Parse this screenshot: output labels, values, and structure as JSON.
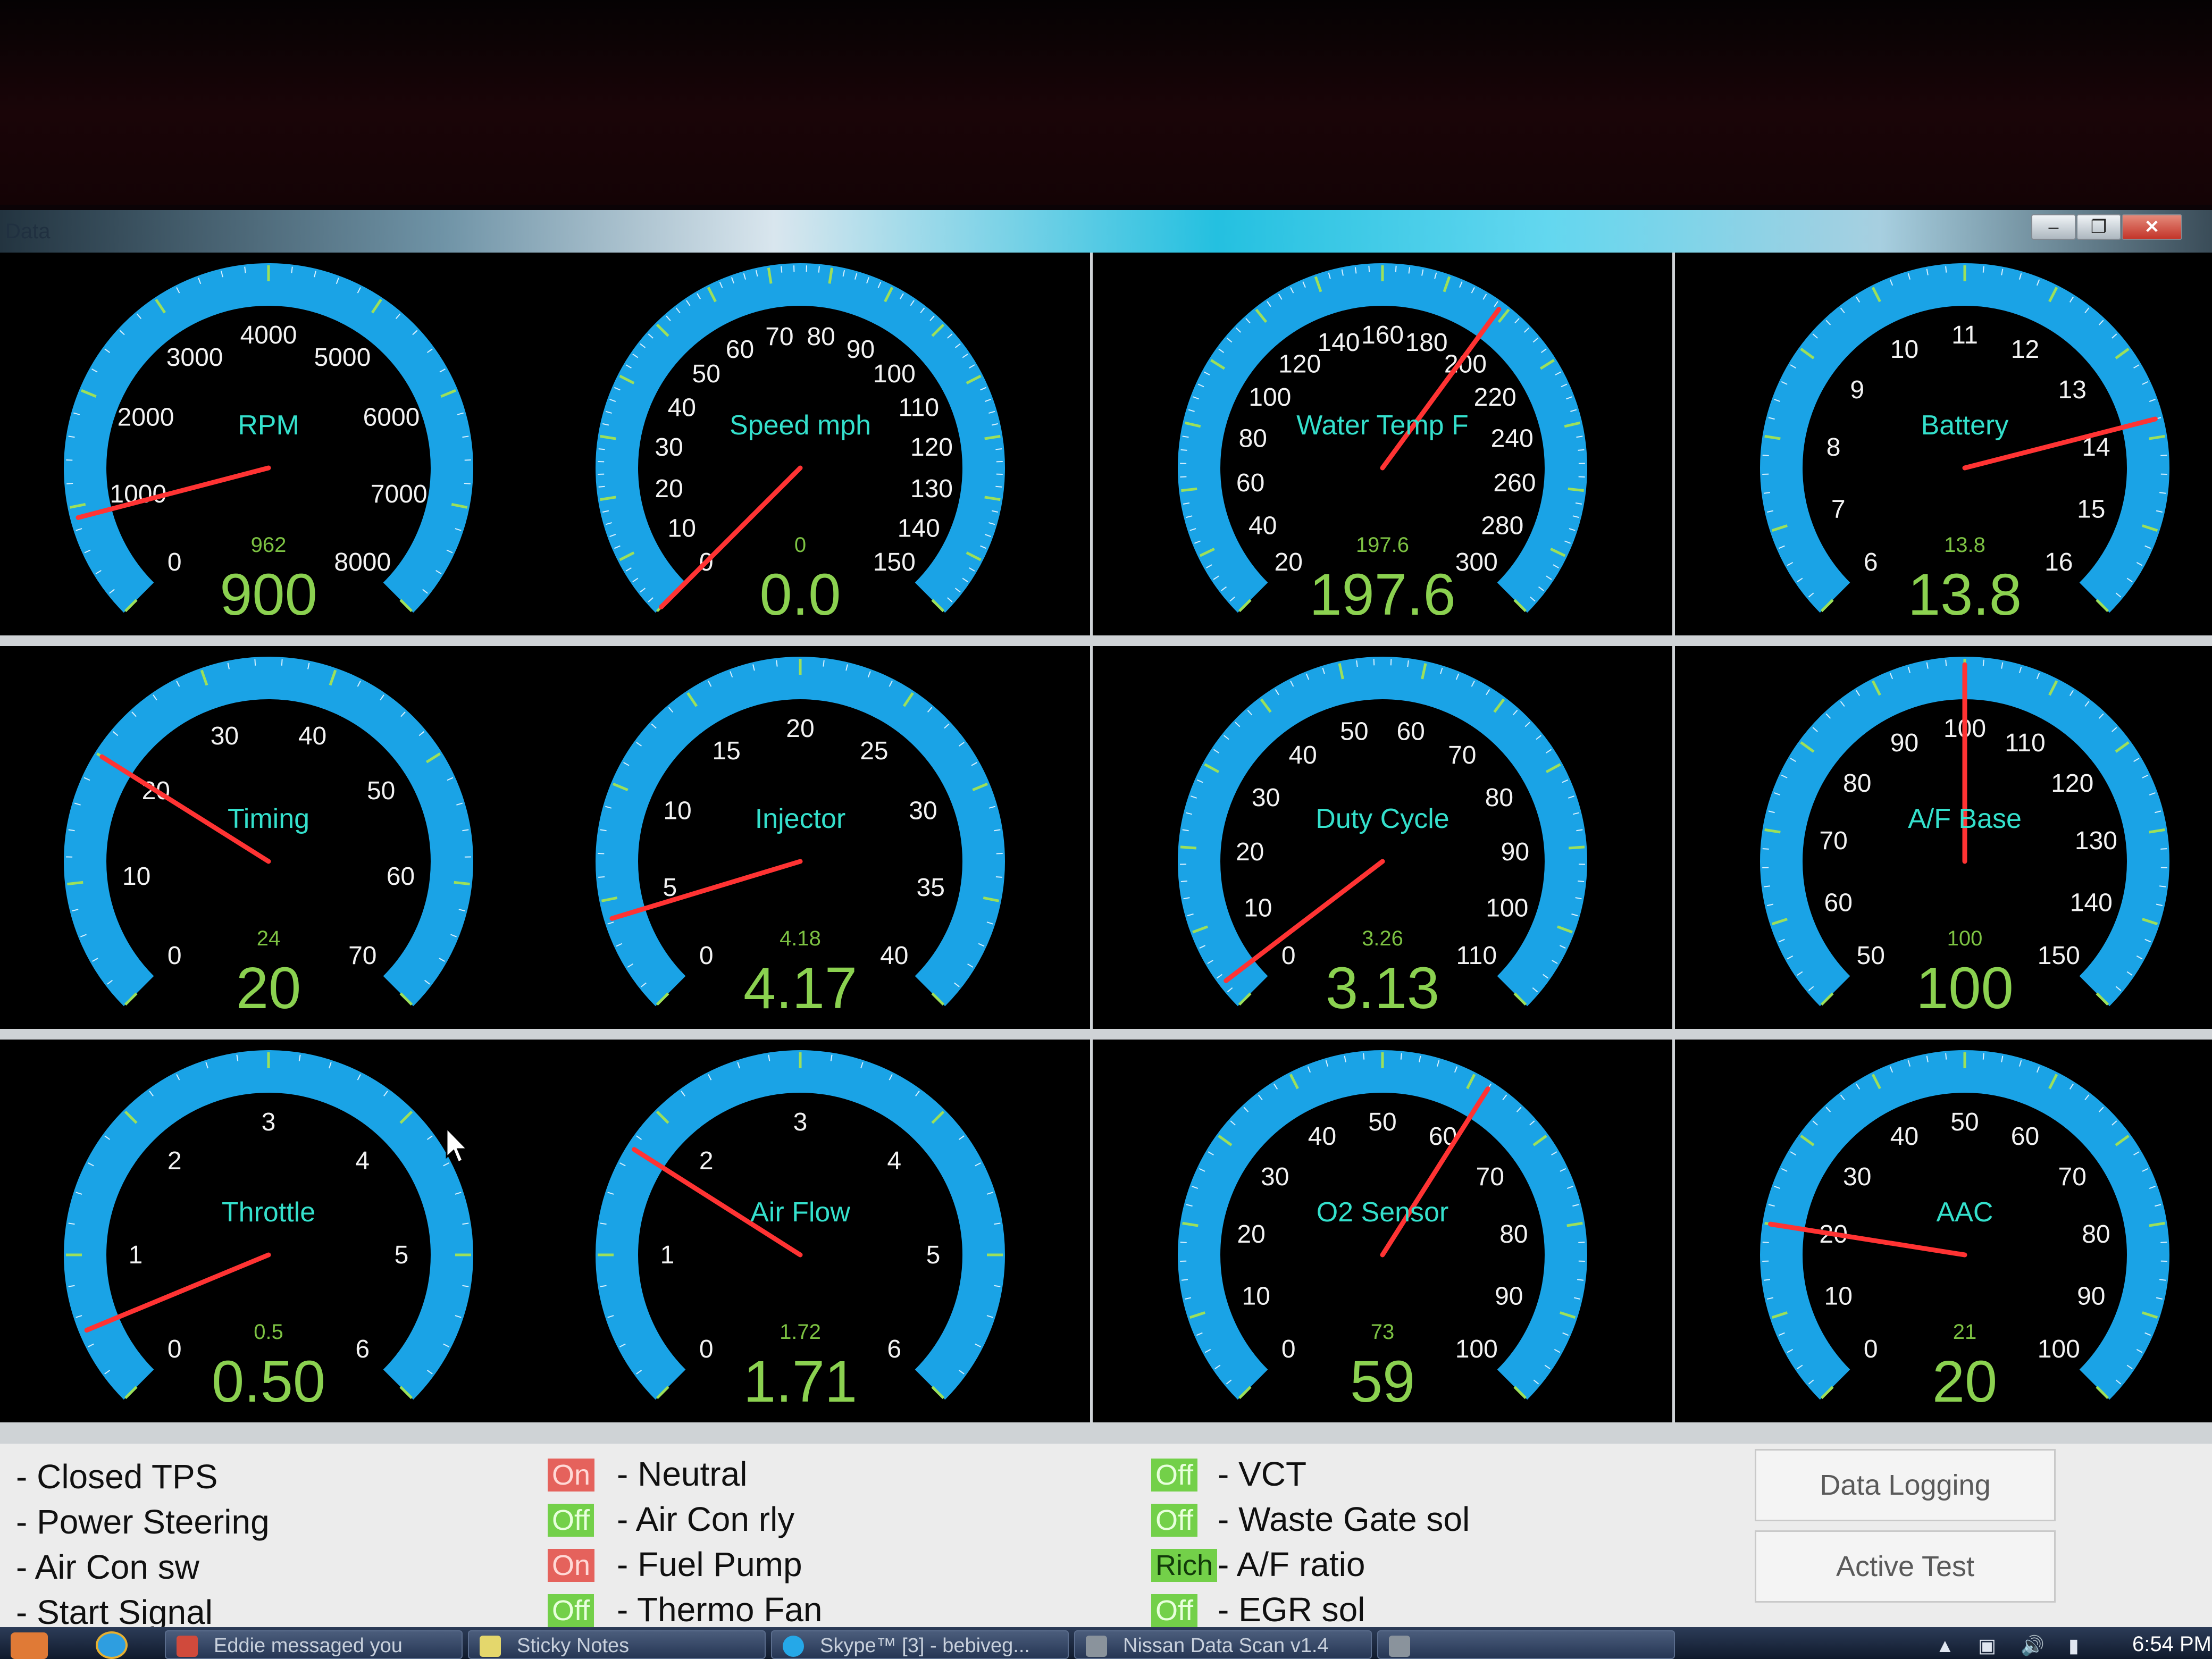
{
  "window": {
    "title": "Data",
    "min_label": "–",
    "max_label": "❐",
    "close_label": "✕"
  },
  "gauges": [
    {
      "label": "RPM",
      "min": 0,
      "max": 8000,
      "ticks": [
        "0",
        "1000",
        "2000",
        "3000",
        "4000",
        "5000",
        "6000",
        "7000",
        "8000"
      ],
      "needle": 900,
      "small": "962",
      "value": "900"
    },
    {
      "label": "Speed mph",
      "min": 0,
      "max": 150,
      "ticks": [
        "0",
        "10",
        "20",
        "30",
        "40",
        "50",
        "60",
        "70",
        "80",
        "90",
        "100",
        "110",
        "120",
        "130",
        "140",
        "150"
      ],
      "needle": 0,
      "small": "0",
      "value": "0.0"
    },
    {
      "label": "Water Temp F",
      "min": 20,
      "max": 300,
      "ticks": [
        "20",
        "40",
        "60",
        "80",
        "100",
        "120",
        "140",
        "160",
        "180",
        "200",
        "220",
        "240",
        "260",
        "280",
        "300"
      ],
      "needle": 197.6,
      "small": "197.6",
      "value": "197.6"
    },
    {
      "label": "Battery",
      "min": 6,
      "max": 16,
      "ticks": [
        "6",
        "7",
        "8",
        "9",
        "10",
        "11",
        "12",
        "13",
        "14",
        "15",
        "16"
      ],
      "needle": 13.8,
      "small": "13.8",
      "value": "13.8"
    },
    {
      "label": "Timing",
      "min": 0,
      "max": 70,
      "ticks": [
        "0",
        "10",
        "20",
        "30",
        "40",
        "50",
        "60",
        "70"
      ],
      "needle": 20,
      "small": "24",
      "value": "20"
    },
    {
      "label": "Injector",
      "min": 0,
      "max": 40,
      "ticks": [
        "0",
        "5",
        "10",
        "15",
        "20",
        "25",
        "30",
        "35",
        "40"
      ],
      "needle": 4.17,
      "small": "4.18",
      "value": "4.17"
    },
    {
      "label": "Duty Cycle",
      "min": 0,
      "max": 110,
      "ticks": [
        "0",
        "10",
        "20",
        "30",
        "40",
        "50",
        "60",
        "70",
        "80",
        "90",
        "100",
        "110"
      ],
      "needle": 3.13,
      "small": "3.26",
      "value": "3.13"
    },
    {
      "label": "A/F Base",
      "min": 50,
      "max": 150,
      "ticks": [
        "50",
        "60",
        "70",
        "80",
        "90",
        "100",
        "110",
        "120",
        "130",
        "140",
        "150"
      ],
      "needle": 100,
      "small": "100",
      "value": "100"
    },
    {
      "label": "Throttle",
      "min": 0,
      "max": 6,
      "ticks": [
        "0",
        "1",
        "2",
        "3",
        "4",
        "5",
        "6"
      ],
      "needle": 0.5,
      "small": "0.5",
      "value": "0.50"
    },
    {
      "label": "Air Flow",
      "min": 0,
      "max": 6,
      "ticks": [
        "0",
        "1",
        "2",
        "3",
        "4",
        "5",
        "6"
      ],
      "needle": 1.72,
      "small": "1.72",
      "value": "1.71"
    },
    {
      "label": "O2 Sensor",
      "min": 0,
      "max": 100,
      "ticks": [
        "0",
        "10",
        "20",
        "30",
        "40",
        "50",
        "60",
        "70",
        "80",
        "90",
        "100"
      ],
      "needle": 62,
      "small": "73",
      "value": "59"
    },
    {
      "label": "AAC",
      "min": 0,
      "max": 100,
      "ticks": [
        "0",
        "10",
        "20",
        "30",
        "40",
        "50",
        "60",
        "70",
        "80",
        "90",
        "100"
      ],
      "needle": 20,
      "small": "21",
      "value": "20"
    }
  ],
  "status": {
    "col1": [
      "- Closed TPS",
      "- Power Steering",
      "- Air Con sw",
      "- Start Signal"
    ],
    "col2": [
      {
        "badge": "On",
        "state": "on",
        "label": "- Neutral"
      },
      {
        "badge": "Off",
        "state": "off",
        "label": "- Air Con rly"
      },
      {
        "badge": "On",
        "state": "on",
        "label": "- Fuel Pump"
      },
      {
        "badge": "Off",
        "state": "off",
        "label": "- Thermo Fan"
      }
    ],
    "col3": [
      {
        "badge": "Off",
        "state": "off",
        "label": "- VCT"
      },
      {
        "badge": "Off",
        "state": "off",
        "label": "- Waste Gate sol"
      },
      {
        "badge": "Rich",
        "state": "rich",
        "label": "- A/F ratio"
      },
      {
        "badge": "Off",
        "state": "off",
        "label": "- EGR sol"
      }
    ],
    "buttons": {
      "data_logging": "Data Logging",
      "active_test": "Active Test"
    }
  },
  "taskbar": {
    "items": [
      "Eddie messaged you",
      "Sticky Notes",
      "Skype™ [3] - bebiveg...",
      "Nissan Data Scan v1.4",
      ""
    ],
    "clock": "6:54 PM"
  },
  "colors": {
    "gauge_arc": "#1aa3e6",
    "needle": "#ff3333",
    "label": "#34e0cc",
    "value": "#8bd150"
  }
}
